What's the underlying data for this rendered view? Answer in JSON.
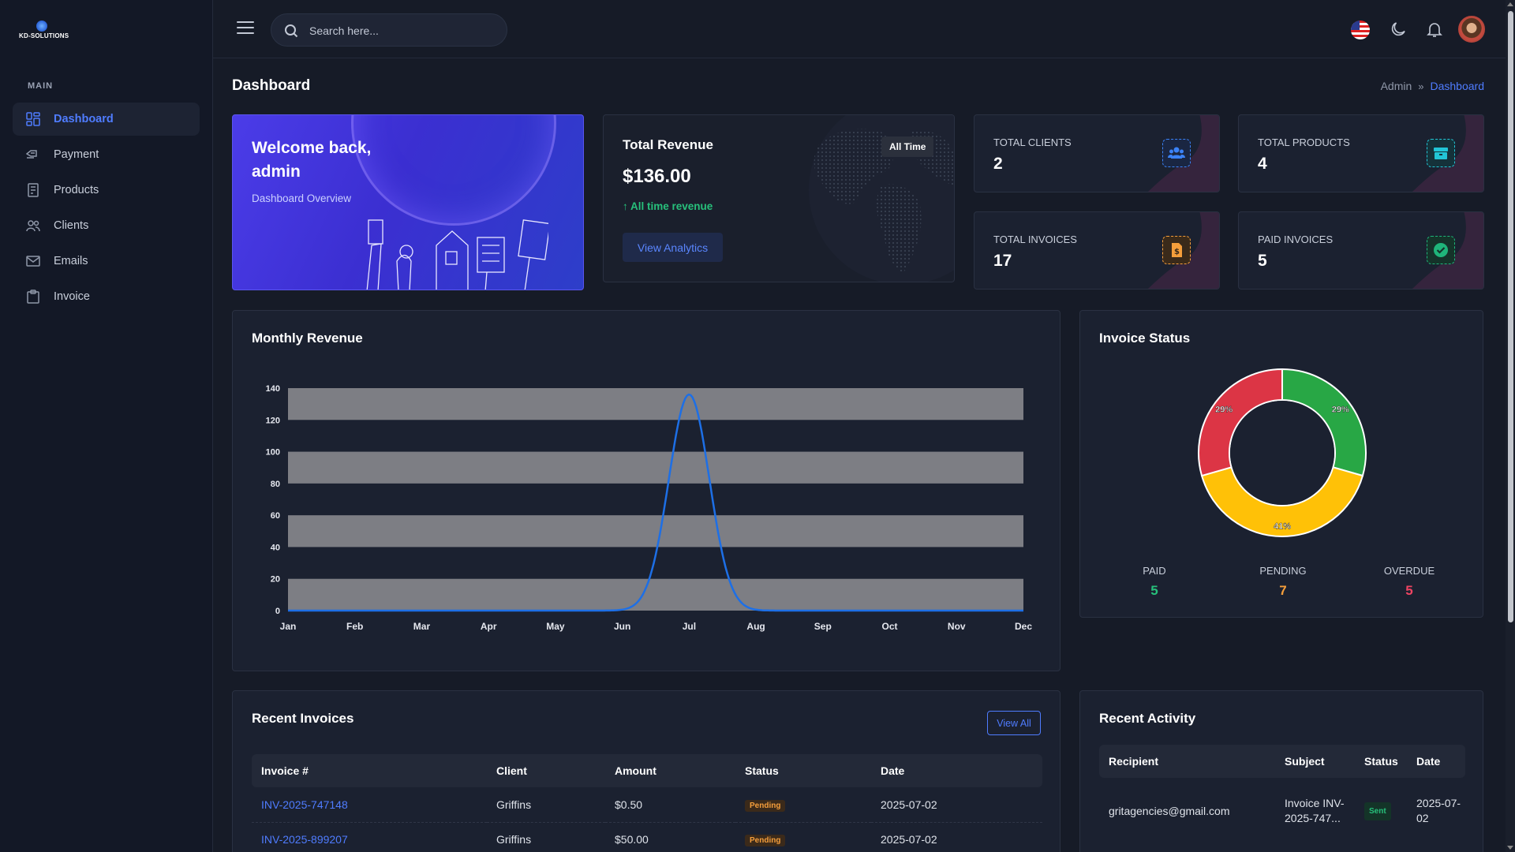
{
  "brand": {
    "name": "KD-SOLUTIONS"
  },
  "sidebar": {
    "section": "MAIN",
    "items": [
      {
        "label": "Dashboard",
        "icon": "grid-icon",
        "active": true
      },
      {
        "label": "Payment",
        "icon": "payment-icon"
      },
      {
        "label": "Products",
        "icon": "product-icon"
      },
      {
        "label": "Clients",
        "icon": "users-icon"
      },
      {
        "label": "Emails",
        "icon": "mail-icon"
      },
      {
        "label": "Invoice",
        "icon": "clipboard-icon"
      }
    ]
  },
  "header": {
    "search_placeholder": "Search here..."
  },
  "page": {
    "title": "Dashboard",
    "breadcrumb": [
      "Admin",
      "Dashboard"
    ]
  },
  "welcome": {
    "title": "Welcome back, admin",
    "subtitle": "Dashboard Overview"
  },
  "revenue": {
    "title": "Total Revenue",
    "value": "$136.00",
    "trend": "All time revenue",
    "button": "View Analytics",
    "badge": "All Time"
  },
  "stats": [
    {
      "label": "TOTAL CLIENTS",
      "value": "2",
      "color": "#3b82f6",
      "icon": "users-icon"
    },
    {
      "label": "TOTAL PRODUCTS",
      "value": "4",
      "color": "#22c5d6",
      "icon": "box-icon"
    },
    {
      "label": "TOTAL INVOICES",
      "value": "17",
      "color": "#f59e3b",
      "icon": "invoice-icon"
    },
    {
      "label": "PAID INVOICES",
      "value": "5",
      "color": "#1fb57a",
      "icon": "check-icon"
    }
  ],
  "monthly": {
    "title": "Monthly Revenue"
  },
  "invoice_status": {
    "title": "Invoice Status",
    "legend": [
      {
        "name": "PAID",
        "value": "5",
        "color": "#27c07b"
      },
      {
        "name": "PENDING",
        "value": "7",
        "color": "#f59e3b"
      },
      {
        "name": "OVERDUE",
        "value": "5",
        "color": "#ef4462"
      }
    ]
  },
  "chart_data": [
    {
      "type": "area",
      "title": "Monthly Revenue",
      "categories": [
        "Jan",
        "Feb",
        "Mar",
        "Apr",
        "May",
        "Jun",
        "Jul",
        "Aug",
        "Sep",
        "Oct",
        "Nov",
        "Dec"
      ],
      "values": [
        0,
        0,
        0,
        0,
        0,
        0,
        136,
        0,
        0,
        0,
        0,
        0
      ],
      "ylim": [
        0,
        140
      ],
      "yticks": [
        0,
        20,
        40,
        60,
        80,
        100,
        120,
        140
      ],
      "color": "#1d6fe6",
      "grid": "banded"
    },
    {
      "type": "pie",
      "title": "Invoice Status",
      "categories": [
        "Paid",
        "Pending",
        "Overdue"
      ],
      "values": [
        5,
        7,
        5
      ],
      "labels": [
        "29%",
        "41%",
        "29%"
      ],
      "colors": [
        "#28a745",
        "#ffc107",
        "#dc3545"
      ],
      "donut": true
    }
  ],
  "recent_invoices": {
    "title": "Recent Invoices",
    "view_all": "View All",
    "columns": [
      "Invoice #",
      "Client",
      "Amount",
      "Status",
      "Date"
    ],
    "rows": [
      {
        "invoice": "INV-2025-747148",
        "client": "Griffins",
        "amount": "$0.50",
        "status": "Pending",
        "date": "2025-07-02"
      },
      {
        "invoice": "INV-2025-899207",
        "client": "Griffins",
        "amount": "$50.00",
        "status": "Pending",
        "date": "2025-07-02"
      }
    ]
  },
  "recent_activity": {
    "title": "Recent Activity",
    "columns": [
      "Recipient",
      "Subject",
      "Status",
      "Date"
    ],
    "rows": [
      {
        "recipient": "gritagencies@gmail.com",
        "subject": "Invoice INV-2025-747...",
        "status": "Sent",
        "date": "2025-07-02"
      }
    ]
  }
}
